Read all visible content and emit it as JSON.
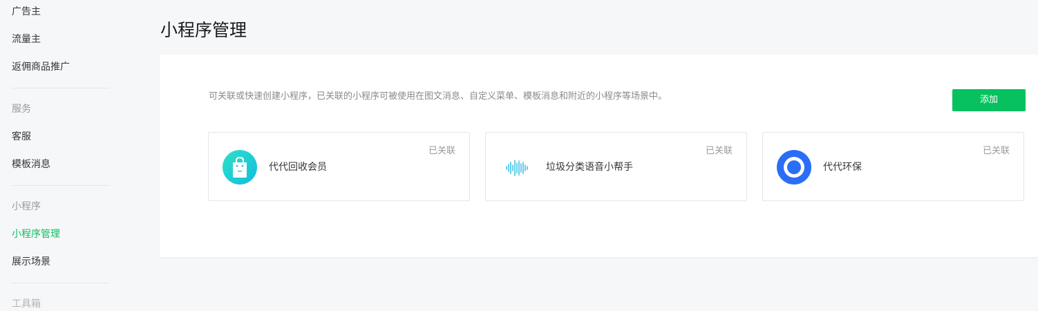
{
  "sidebar": {
    "items_top": [
      "广告主",
      "流量主",
      "返佣商品推广"
    ],
    "group_service": {
      "title": "服务",
      "items": [
        "客服",
        "模板消息"
      ]
    },
    "group_miniprogram": {
      "title": "小程序",
      "items": [
        "小程序管理",
        "展示场景"
      ]
    },
    "partial_next_group": "工具箱"
  },
  "page": {
    "title": "小程序管理",
    "description": "可关联或快速创建小程序，已关联的小程序可被使用在图文消息、自定义菜单、模板消息和附近的小程序等场景中。",
    "add_button": "添加"
  },
  "cards": [
    {
      "name": "代代回收会员",
      "status": "已关联",
      "icon": "shopping-bag-icon"
    },
    {
      "name": "垃圾分类语音小帮手",
      "status": "已关联",
      "icon": "sound-wave-icon"
    },
    {
      "name": "代代环保",
      "status": "已关联",
      "icon": "ring-logo-icon"
    }
  ],
  "colors": {
    "accent": "#07c160",
    "page_bg": "#f6f7f9",
    "card_icon_teal": "#19d3c5",
    "wave_icon": "#3fc2e5",
    "ring_icon": "#2b6ef6"
  }
}
